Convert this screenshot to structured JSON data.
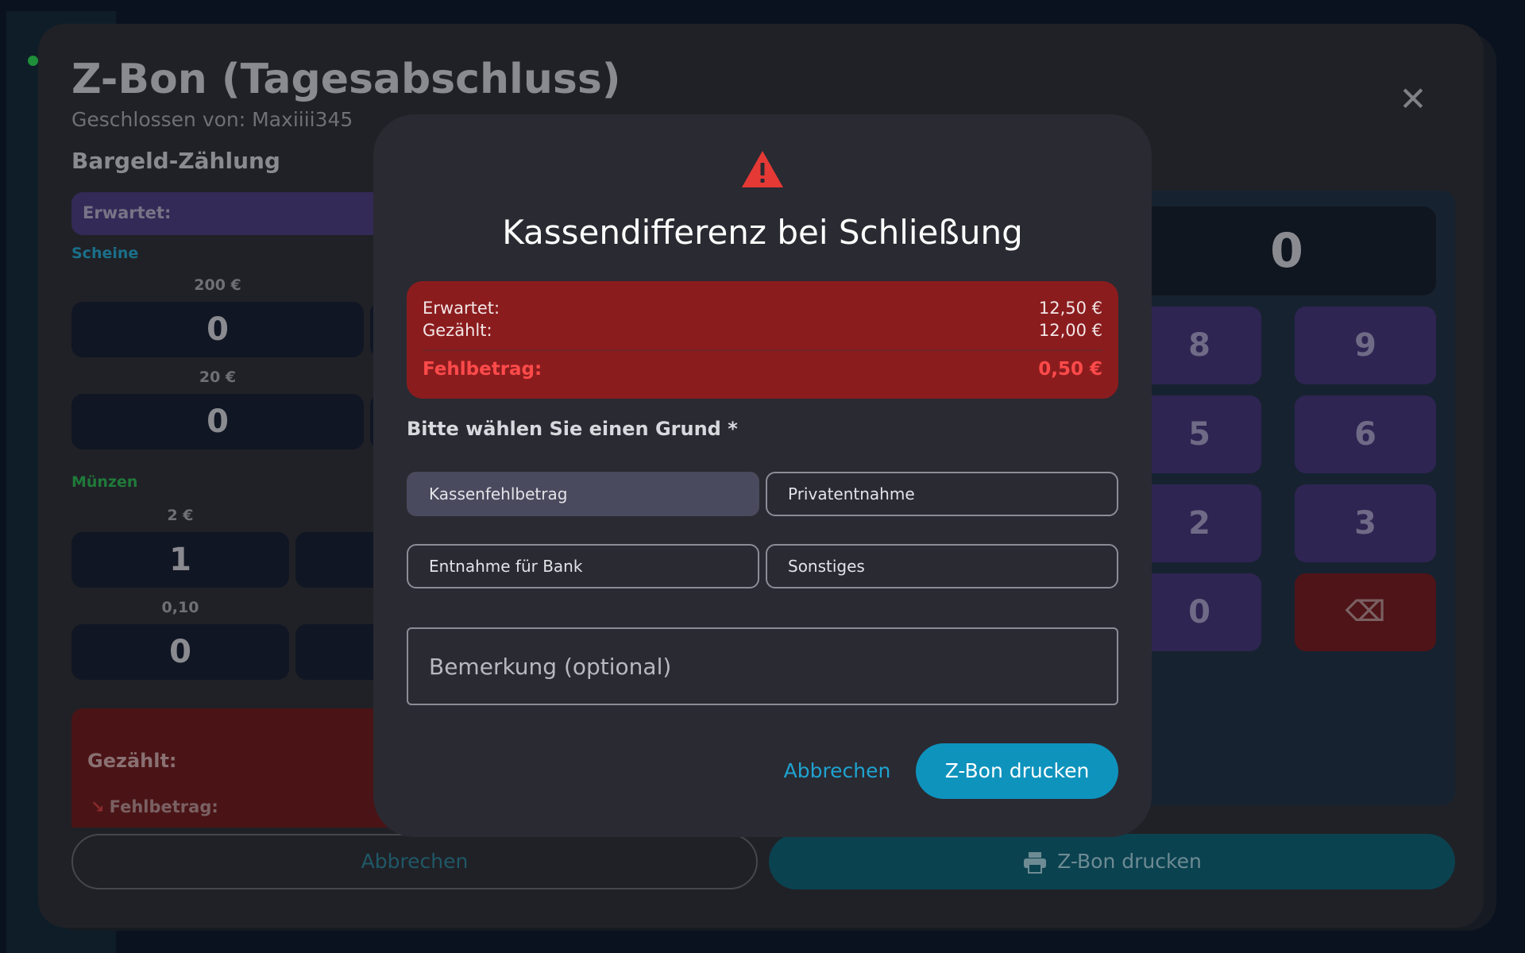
{
  "background": {
    "window": {
      "title": "Z-Bon (Tagesabschluss)",
      "subtitle": "Geschlossen von: Maxiiii345",
      "close_icon": "close-icon",
      "section_title": "Bargeld-Zählung",
      "expected_label": "Erwartet:",
      "bills_label": "Scheine",
      "coins_label": "Münzen",
      "bills": [
        {
          "denomination": "200 €",
          "count": "0"
        },
        {
          "denomination": "20 €",
          "count": "0"
        }
      ],
      "coins": [
        {
          "denomination": "2 €",
          "count": "1"
        },
        {
          "denomination": "0,10",
          "count": "0"
        }
      ],
      "summary": {
        "counted_label": "Gezählt:",
        "shortfall_label": "Fehlbetrag:"
      },
      "keypad": {
        "display": "0",
        "keys": [
          "8",
          "9",
          "5",
          "6",
          "2",
          "3",
          "0"
        ],
        "delete_icon": "backspace-icon"
      },
      "cancel_label": "Abbrechen",
      "print_label": "Z-Bon drucken",
      "print_icon": "printer-icon"
    }
  },
  "modal": {
    "icon": "warning-icon",
    "title": "Kassendifferenz bei Schließung",
    "expected_label": "Erwartet:",
    "expected_value": "12,50 €",
    "counted_label": "Gezählt:",
    "counted_value": "12,00 €",
    "shortfall_label": "Fehlbetrag:",
    "shortfall_value": "0,50 €",
    "reason_prompt": "Bitte wählen Sie einen Grund *",
    "reasons": [
      {
        "label": "Kassenfehlbetrag",
        "selected": true
      },
      {
        "label": "Privatentnahme",
        "selected": false
      },
      {
        "label": "Entnahme für Bank",
        "selected": false
      },
      {
        "label": "Sonstiges",
        "selected": false
      }
    ],
    "remark_placeholder": "Bemerkung (optional)",
    "cancel_label": "Abbrechen",
    "print_label": "Z-Bon drucken"
  },
  "colors": {
    "accent": "#0e93bd",
    "danger_bg": "#8b1c1e",
    "danger_text": "#ff4a4a",
    "warning_icon": "#e53935",
    "bills_label": "#1a6f8a",
    "coins_label": "#1f7a3a"
  }
}
